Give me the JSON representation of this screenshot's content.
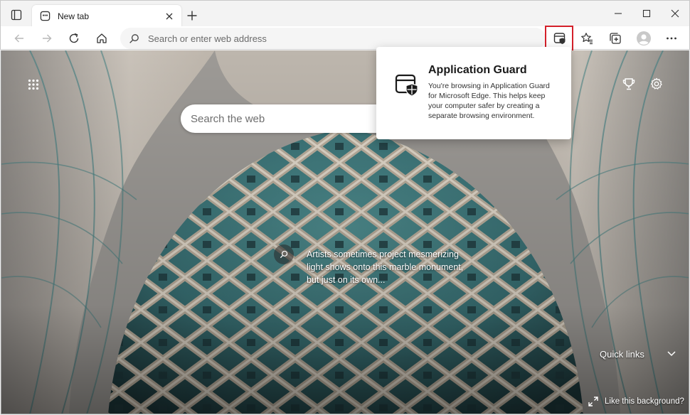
{
  "tab": {
    "title": "New tab"
  },
  "toolbar": {
    "address_placeholder": "Search or enter web address"
  },
  "new_tab_page": {
    "search_placeholder": "Search the web",
    "caption_lines": [
      "Artists sometimes project mesmerizing",
      "light shows onto this marble monument,",
      "but just on its own..."
    ],
    "quick_links_label": "Quick links",
    "like_background_label": "Like this background?"
  },
  "flyout": {
    "title": "Application Guard",
    "body_lines": [
      "You're browsing in Application Guard",
      "for Microsoft Edge. This helps keep",
      "your computer safer by creating a",
      "separate browsing environment."
    ]
  },
  "icons": {
    "tab_actions": "tab-actions-icon",
    "favicon": "new-tab-favicon",
    "back": "back-arrow-icon",
    "forward": "forward-arrow-icon",
    "refresh": "refresh-icon",
    "home": "home-icon",
    "search": "search-icon",
    "app_guard": "application-guard-icon",
    "favorites": "favorites-icon",
    "collections": "collections-icon",
    "profile": "profile-avatar",
    "more": "more-icon",
    "apps": "apps-grid-icon",
    "rewards": "rewards-trophy-icon",
    "settings": "gear-icon",
    "expand": "expand-icon",
    "chevron": "chevron-down-icon"
  },
  "colors": {
    "highlight_border": "#d4202a",
    "tile_teal": "#3f7d80",
    "stone": "#c8bfb3"
  }
}
